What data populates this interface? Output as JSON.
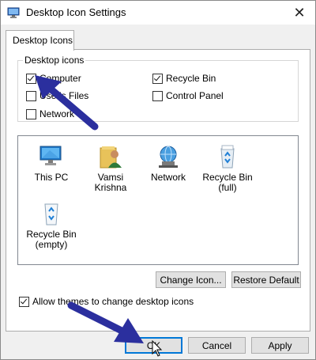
{
  "window": {
    "title": "Desktop Icon Settings",
    "close_glyph": "✕"
  },
  "tab": {
    "label": "Desktop Icons"
  },
  "group": {
    "label": "Desktop icons",
    "checkboxes": [
      {
        "label": "Computer",
        "checked": true
      },
      {
        "label": "Recycle Bin",
        "checked": true
      },
      {
        "label": "User's Files",
        "checked": false
      },
      {
        "label": "Control Panel",
        "checked": false
      },
      {
        "label": "Network",
        "checked": false
      }
    ]
  },
  "icons": [
    {
      "label": "This PC",
      "icon": "computer-icon"
    },
    {
      "label": "Vamsi Krishna",
      "icon": "user-folder-icon"
    },
    {
      "label": "Network",
      "icon": "network-icon"
    },
    {
      "label": "Recycle Bin",
      "label2": "(full)",
      "icon": "recycle-bin-full-icon"
    },
    {
      "label": "Recycle Bin",
      "label2": "(empty)",
      "icon": "recycle-bin-empty-icon"
    }
  ],
  "buttons": {
    "change_icon": "Change Icon...",
    "restore_default": "Restore Default",
    "ok": "OK",
    "cancel": "Cancel",
    "apply": "Apply"
  },
  "allow_themes": {
    "label": "Allow themes to change desktop icons",
    "checked": true
  },
  "colors": {
    "arrow": "#2b2f9e",
    "accent": "#0078d7"
  }
}
